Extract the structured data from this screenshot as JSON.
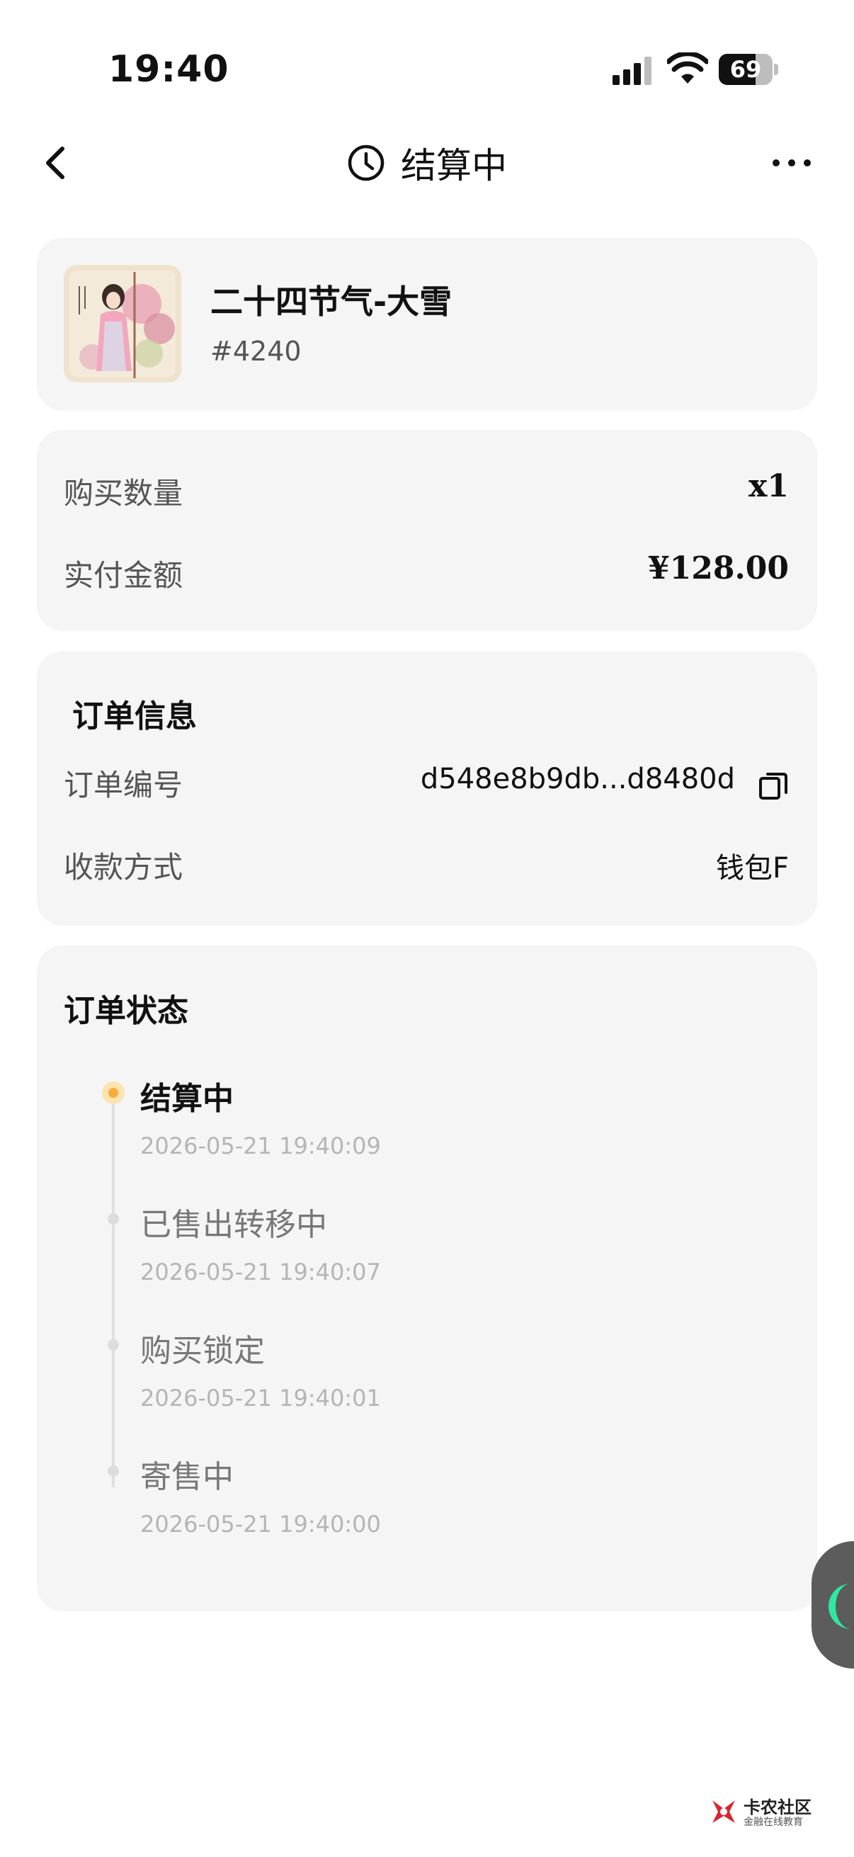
{
  "status_bar": {
    "time": "19:40",
    "battery": "69",
    "battery_level": 0.69
  },
  "nav": {
    "title": "结算中",
    "back_icon": "chevron-left-icon",
    "more_icon": "more-horizontal-icon",
    "title_icon": "clock-icon"
  },
  "product": {
    "name": "二十四节气-大雪",
    "id": "#4240"
  },
  "payment": {
    "quantity_label": "购买数量",
    "quantity_value": "x1",
    "amount_label": "实付金额",
    "amount_value": "¥128.00"
  },
  "order_info": {
    "title": "订单信息",
    "order_no_label": "订单编号",
    "order_no_value": "d548e8b9db...d8480d",
    "payment_method_label": "收款方式",
    "payment_method_value": "钱包F"
  },
  "order_status": {
    "title": "订单状态",
    "steps": [
      {
        "label": "结算中",
        "time": "2026-05-21 19:40:09",
        "active": true
      },
      {
        "label": "已售出转移中",
        "time": "2026-05-21 19:40:07",
        "active": false
      },
      {
        "label": "购买锁定",
        "time": "2026-05-21 19:40:01",
        "active": false
      },
      {
        "label": "寄售中",
        "time": "2026-05-21 19:40:00",
        "active": false
      }
    ]
  },
  "watermark": {
    "title": "卡农社区",
    "subtitle": "金融在线教育"
  },
  "colors": {
    "card_bg": "#f5f5f5",
    "active_dot": "#f6ad3a",
    "float_accent": "#2ee8a0"
  }
}
